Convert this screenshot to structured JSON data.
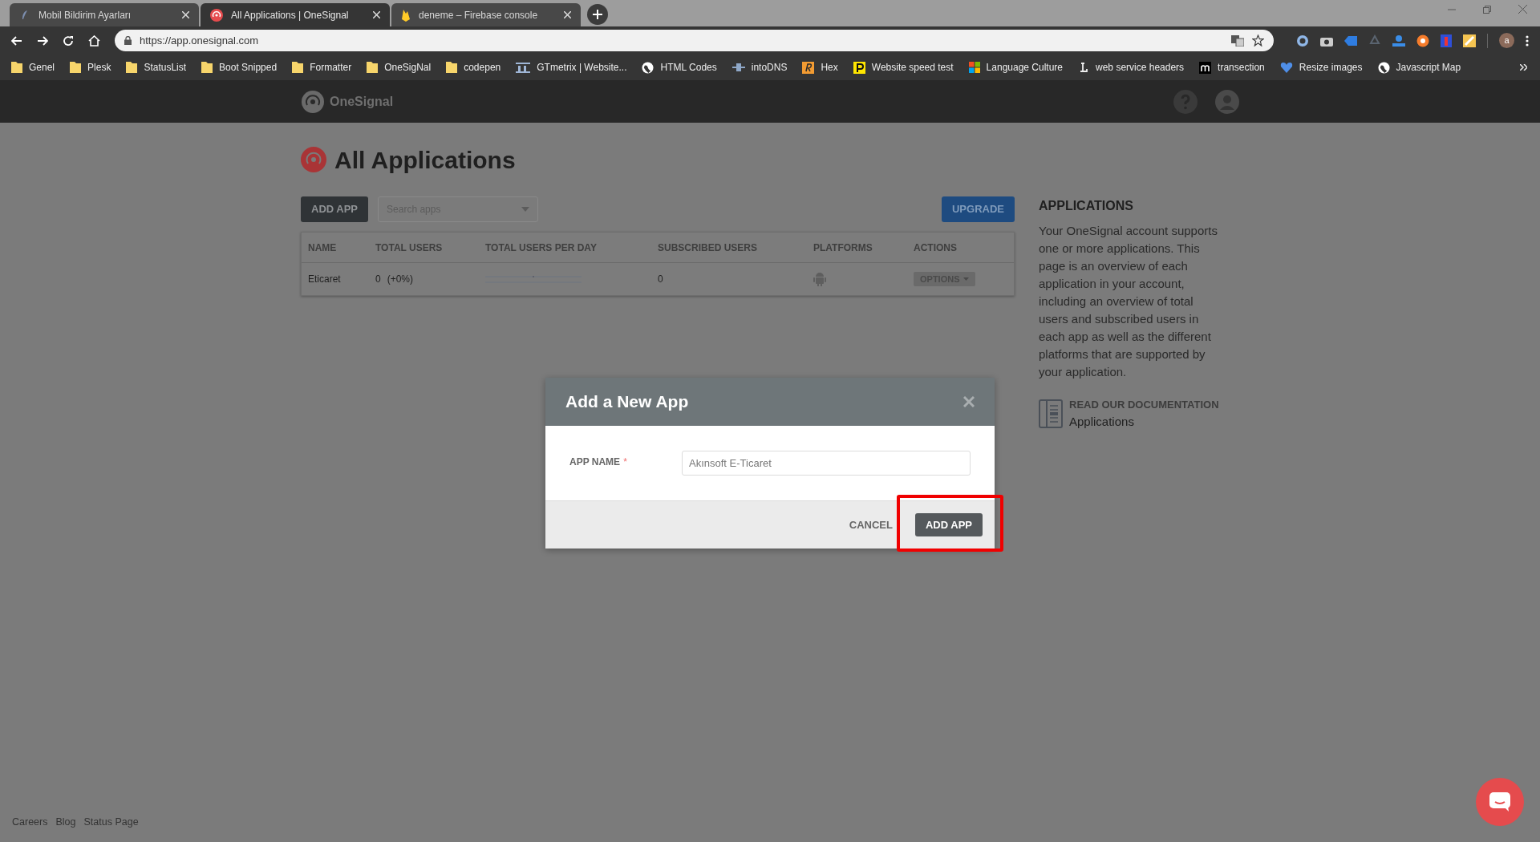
{
  "browser": {
    "tabs": [
      {
        "title": "Mobil Bildirim Ayarları",
        "selected": false,
        "kind": "feather"
      },
      {
        "title": "All Applications | OneSignal",
        "selected": true,
        "kind": "signal"
      },
      {
        "title": "deneme – Firebase console",
        "selected": false,
        "kind": "fire"
      }
    ],
    "address": "https://app.onesignal.com",
    "bookmarks": [
      {
        "label": "Genel",
        "kind": "folder"
      },
      {
        "label": "Plesk",
        "kind": "folder"
      },
      {
        "label": "StatusList",
        "kind": "folder"
      },
      {
        "label": "Boot Snipped",
        "kind": "folder"
      },
      {
        "label": "Formatter",
        "kind": "folder"
      },
      {
        "label": "OneSigNal",
        "kind": "folder"
      },
      {
        "label": "codepen",
        "kind": "folder"
      },
      {
        "label": "GTmetrix | Website...",
        "kind": "gt"
      },
      {
        "label": "HTML Codes",
        "kind": "globe"
      },
      {
        "label": "intoDNS",
        "kind": "plug"
      },
      {
        "label": "Hex",
        "kind": "r"
      },
      {
        "label": "Website speed test",
        "kind": "p"
      },
      {
        "label": "Language Culture",
        "kind": "ms"
      },
      {
        "label": "web service headers",
        "kind": "l"
      },
      {
        "label": "transection",
        "kind": "m"
      },
      {
        "label": "Resize images",
        "kind": "heart"
      },
      {
        "label": "Javascript Map",
        "kind": "globe"
      }
    ],
    "profile_initial": "a"
  },
  "app_header": {
    "logo": "OneSignal"
  },
  "page": {
    "title": "All Applications",
    "add_button": "ADD APP",
    "search": {
      "placeholder": "Search apps"
    },
    "upgrade_button": "UPGRADE",
    "table": {
      "columns": [
        "NAME",
        "TOTAL USERS",
        "TOTAL USERS PER DAY",
        "SUBSCRIBED USERS",
        "PLATFORMS",
        "ACTIONS"
      ],
      "rows": [
        {
          "name": "Eticaret",
          "total_users": "0",
          "change": "(+0%)",
          "subscribed_users": "0",
          "options": "OPTIONS"
        }
      ]
    }
  },
  "sidebar": {
    "heading": "APPLICATIONS",
    "text": "Your OneSignal account supports one or more applications. This page is an overview of each application in your account, including an overview of total users and subscribed users in each app as well as the different platforms that are supported by your application.",
    "doc_label": "READ OUR DOCUMENTATION",
    "doc_link": "Applications"
  },
  "modal": {
    "title": "Add a New App",
    "field_label": "APP NAME",
    "required_mark": "*",
    "field_value": "Akınsoft E-Ticaret",
    "cancel": "CANCEL",
    "submit": "ADD APP"
  },
  "footer": {
    "links": [
      "Careers",
      "Blog",
      "Status Page"
    ]
  }
}
